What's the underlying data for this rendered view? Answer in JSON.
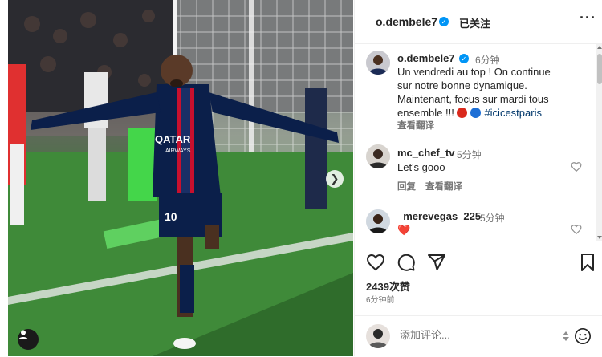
{
  "post": {
    "author": "o.dembele7",
    "follow_label": "已关注",
    "more_label": "···",
    "caption_time": "6分钟",
    "caption_lines": [
      "Un vendredi au top ! On continue",
      "sur notre bonne dynamique.",
      "Maintenant, focus sur mardi tous",
      "ensemble !!! "
    ],
    "caption_hashtag": "#icicestparis",
    "see_translation": "查看翻译",
    "likes": "2439次赞",
    "posted_ago": "6分钟前"
  },
  "comments": [
    {
      "user": "mc_chef_tv",
      "time": "5分钟",
      "text": "Let's gooo",
      "reply_label": "回复",
      "translate_label": "查看翻译"
    },
    {
      "user": "_merevegas_225",
      "time": "5分钟",
      "text": "❤️"
    }
  ],
  "composer": {
    "placeholder": "添加评论..."
  },
  "colors": {
    "verified": "#0095f6",
    "psg_red": "#da291c",
    "psg_blue": "#004170"
  },
  "icons": [
    "verified-icon",
    "heart-icon",
    "comment-icon",
    "share-icon",
    "bookmark-icon",
    "emoji-icon",
    "next-arrow-icon",
    "user-tag-icon"
  ]
}
